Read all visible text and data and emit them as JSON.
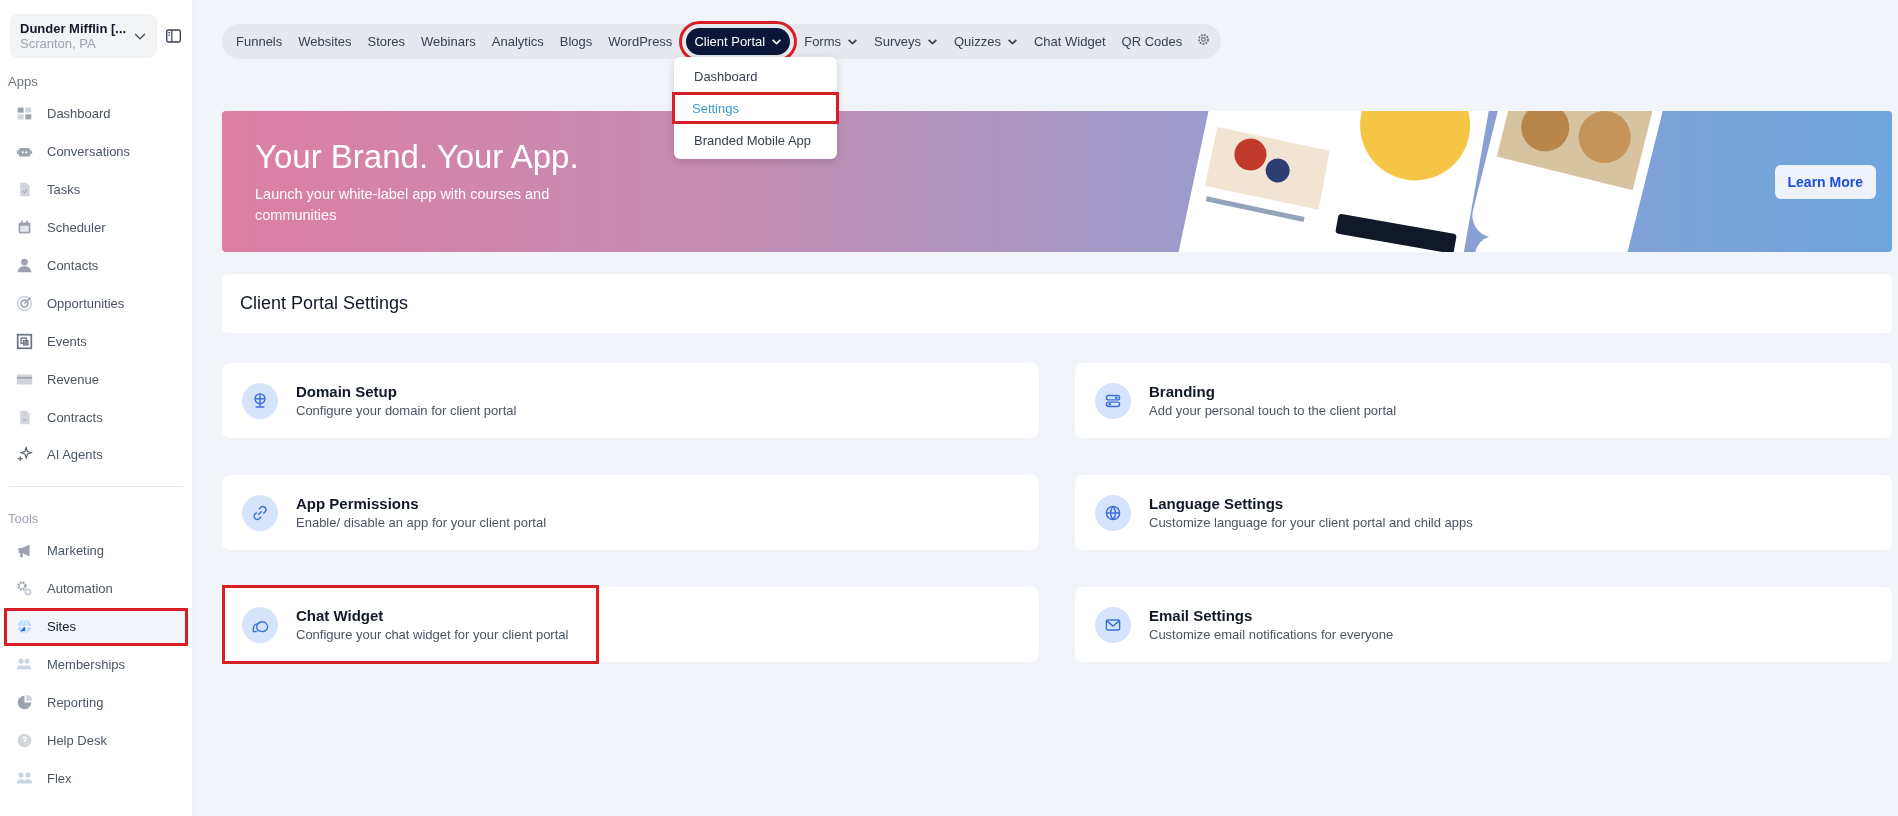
{
  "account": {
    "name": "Dunder Mifflin [...",
    "location": "Scranton, PA"
  },
  "sidebar": {
    "sections": [
      {
        "title": "Apps",
        "items": [
          {
            "label": "Dashboard",
            "selected": false,
            "highlighted": false
          },
          {
            "label": "Conversations",
            "selected": false,
            "highlighted": false
          },
          {
            "label": "Tasks",
            "selected": false,
            "highlighted": false
          },
          {
            "label": "Scheduler",
            "selected": false,
            "highlighted": false
          },
          {
            "label": "Contacts",
            "selected": false,
            "highlighted": false
          },
          {
            "label": "Opportunities",
            "selected": false,
            "highlighted": false
          },
          {
            "label": "Events",
            "selected": false,
            "highlighted": false
          },
          {
            "label": "Revenue",
            "selected": false,
            "highlighted": false
          },
          {
            "label": "Contracts",
            "selected": false,
            "highlighted": false
          },
          {
            "label": "AI Agents",
            "selected": false,
            "highlighted": false
          }
        ]
      },
      {
        "title": "Tools",
        "items": [
          {
            "label": "Marketing",
            "selected": false,
            "highlighted": false
          },
          {
            "label": "Automation",
            "selected": false,
            "highlighted": false
          },
          {
            "label": "Sites",
            "selected": true,
            "highlighted": true
          },
          {
            "label": "Memberships",
            "selected": false,
            "highlighted": false
          },
          {
            "label": "Reporting",
            "selected": false,
            "highlighted": false
          },
          {
            "label": "Help Desk",
            "selected": false,
            "highlighted": false
          },
          {
            "label": "Flex",
            "selected": false,
            "highlighted": false
          }
        ]
      }
    ]
  },
  "nav": {
    "tabs": [
      {
        "label": "Funnels",
        "selected": false,
        "dropdown": false,
        "highlighted": false
      },
      {
        "label": "Websites",
        "selected": false,
        "dropdown": false,
        "highlighted": false
      },
      {
        "label": "Stores",
        "selected": false,
        "dropdown": false,
        "highlighted": false
      },
      {
        "label": "Webinars",
        "selected": false,
        "dropdown": false,
        "highlighted": false
      },
      {
        "label": "Analytics",
        "selected": false,
        "dropdown": false,
        "highlighted": false
      },
      {
        "label": "Blogs",
        "selected": false,
        "dropdown": false,
        "highlighted": false
      },
      {
        "label": "WordPress",
        "selected": false,
        "dropdown": false,
        "highlighted": false
      },
      {
        "label": "Client Portal",
        "selected": true,
        "dropdown": true,
        "highlighted": true
      },
      {
        "label": "Forms",
        "selected": false,
        "dropdown": true,
        "highlighted": false
      },
      {
        "label": "Surveys",
        "selected": false,
        "dropdown": true,
        "highlighted": false
      },
      {
        "label": "Quizzes",
        "selected": false,
        "dropdown": true,
        "highlighted": false
      },
      {
        "label": "Chat Widget",
        "selected": false,
        "dropdown": false,
        "highlighted": false
      },
      {
        "label": "QR Codes",
        "selected": false,
        "dropdown": false,
        "highlighted": false
      }
    ]
  },
  "dropdown": {
    "items": [
      {
        "label": "Dashboard",
        "selected": false,
        "highlighted": false
      },
      {
        "label": "Settings",
        "selected": true,
        "highlighted": true
      },
      {
        "label": "Branded Mobile App",
        "selected": false,
        "highlighted": false
      }
    ]
  },
  "banner": {
    "title": "Your Brand. Your App.",
    "subtitle": "Launch your white-label app with courses and communities",
    "button": "Learn More"
  },
  "section_title": "Client Portal Settings",
  "cards": [
    {
      "title": "Domain Setup",
      "description": "Configure your domain for client portal",
      "highlighted": false
    },
    {
      "title": "Branding",
      "description": "Add your personal touch to the client portal",
      "highlighted": false
    },
    {
      "title": "App Permissions",
      "description": "Enable/ disable an app for your client portal",
      "highlighted": false
    },
    {
      "title": "Language Settings",
      "description": "Customize language for your client portal and child apps",
      "highlighted": false
    },
    {
      "title": "Chat Widget",
      "description": "Configure your chat widget for your client portal",
      "highlighted": true
    },
    {
      "title": "Email Settings",
      "description": "Customize email notifications for everyone",
      "highlighted": false
    }
  ]
}
